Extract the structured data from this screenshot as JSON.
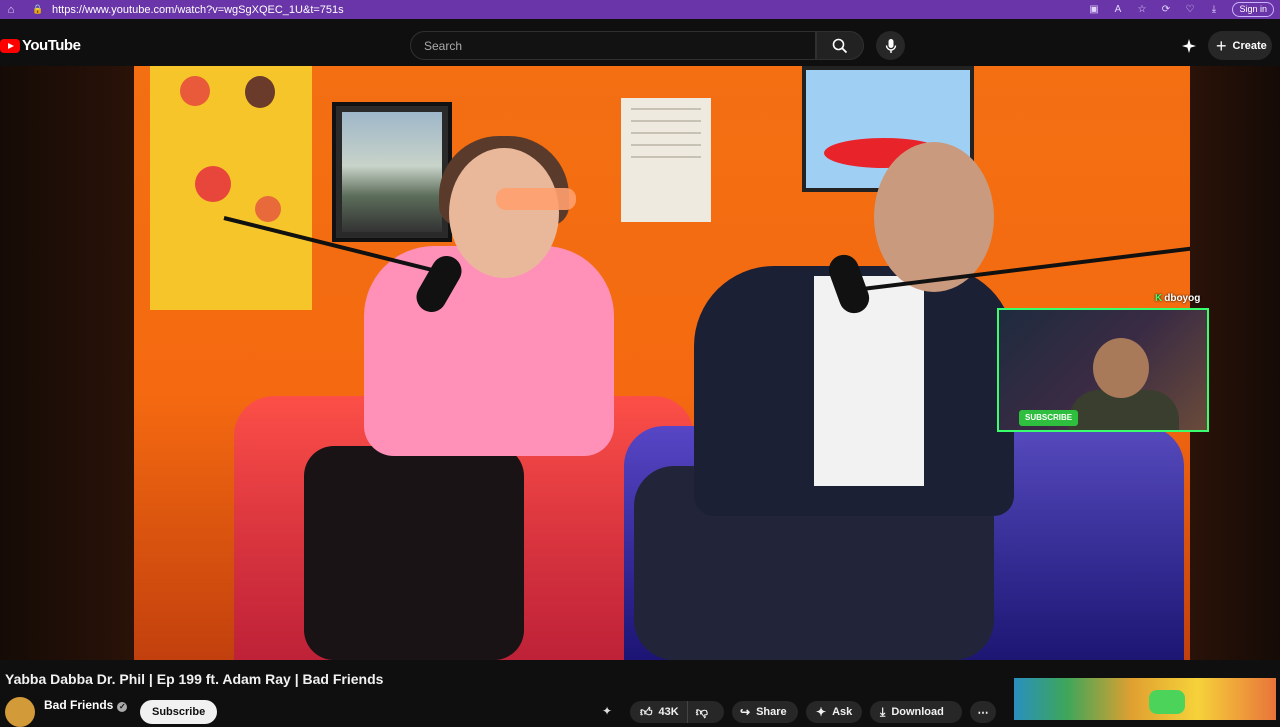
{
  "browser": {
    "url": "https://www.youtube.com/watch?v=wgSgXQEC_1U&t=751s",
    "signin_label": "Sign in"
  },
  "header": {
    "logo_text": "YouTube",
    "search_placeholder": "Search",
    "create_label": "Create"
  },
  "video": {
    "overlay_username": "dboyog",
    "overlay_subscribe_label": "SUBSCRIBE"
  },
  "details": {
    "title": "Yabba Dabba Dr. Phil | Ep 199 ft. Adam Ray | Bad Friends",
    "channel_name": "Bad Friends",
    "subscribe_label": "Subscribe",
    "like_count": "43K",
    "share_label": "Share",
    "ask_label": "Ask",
    "download_label": "Download"
  },
  "colors": {
    "browser_bar": "#6a35a8",
    "youtube_red": "#ff0000",
    "background": "#0f0f0f",
    "overlay_border": "#39ff6e"
  },
  "icons": [
    "home-icon",
    "lock-icon",
    "search-icon",
    "mic-icon",
    "sparkle-icon",
    "plus-icon",
    "verified-icon",
    "like-icon",
    "dislike-icon",
    "share-icon",
    "ask-icon",
    "download-icon",
    "more-icon"
  ]
}
